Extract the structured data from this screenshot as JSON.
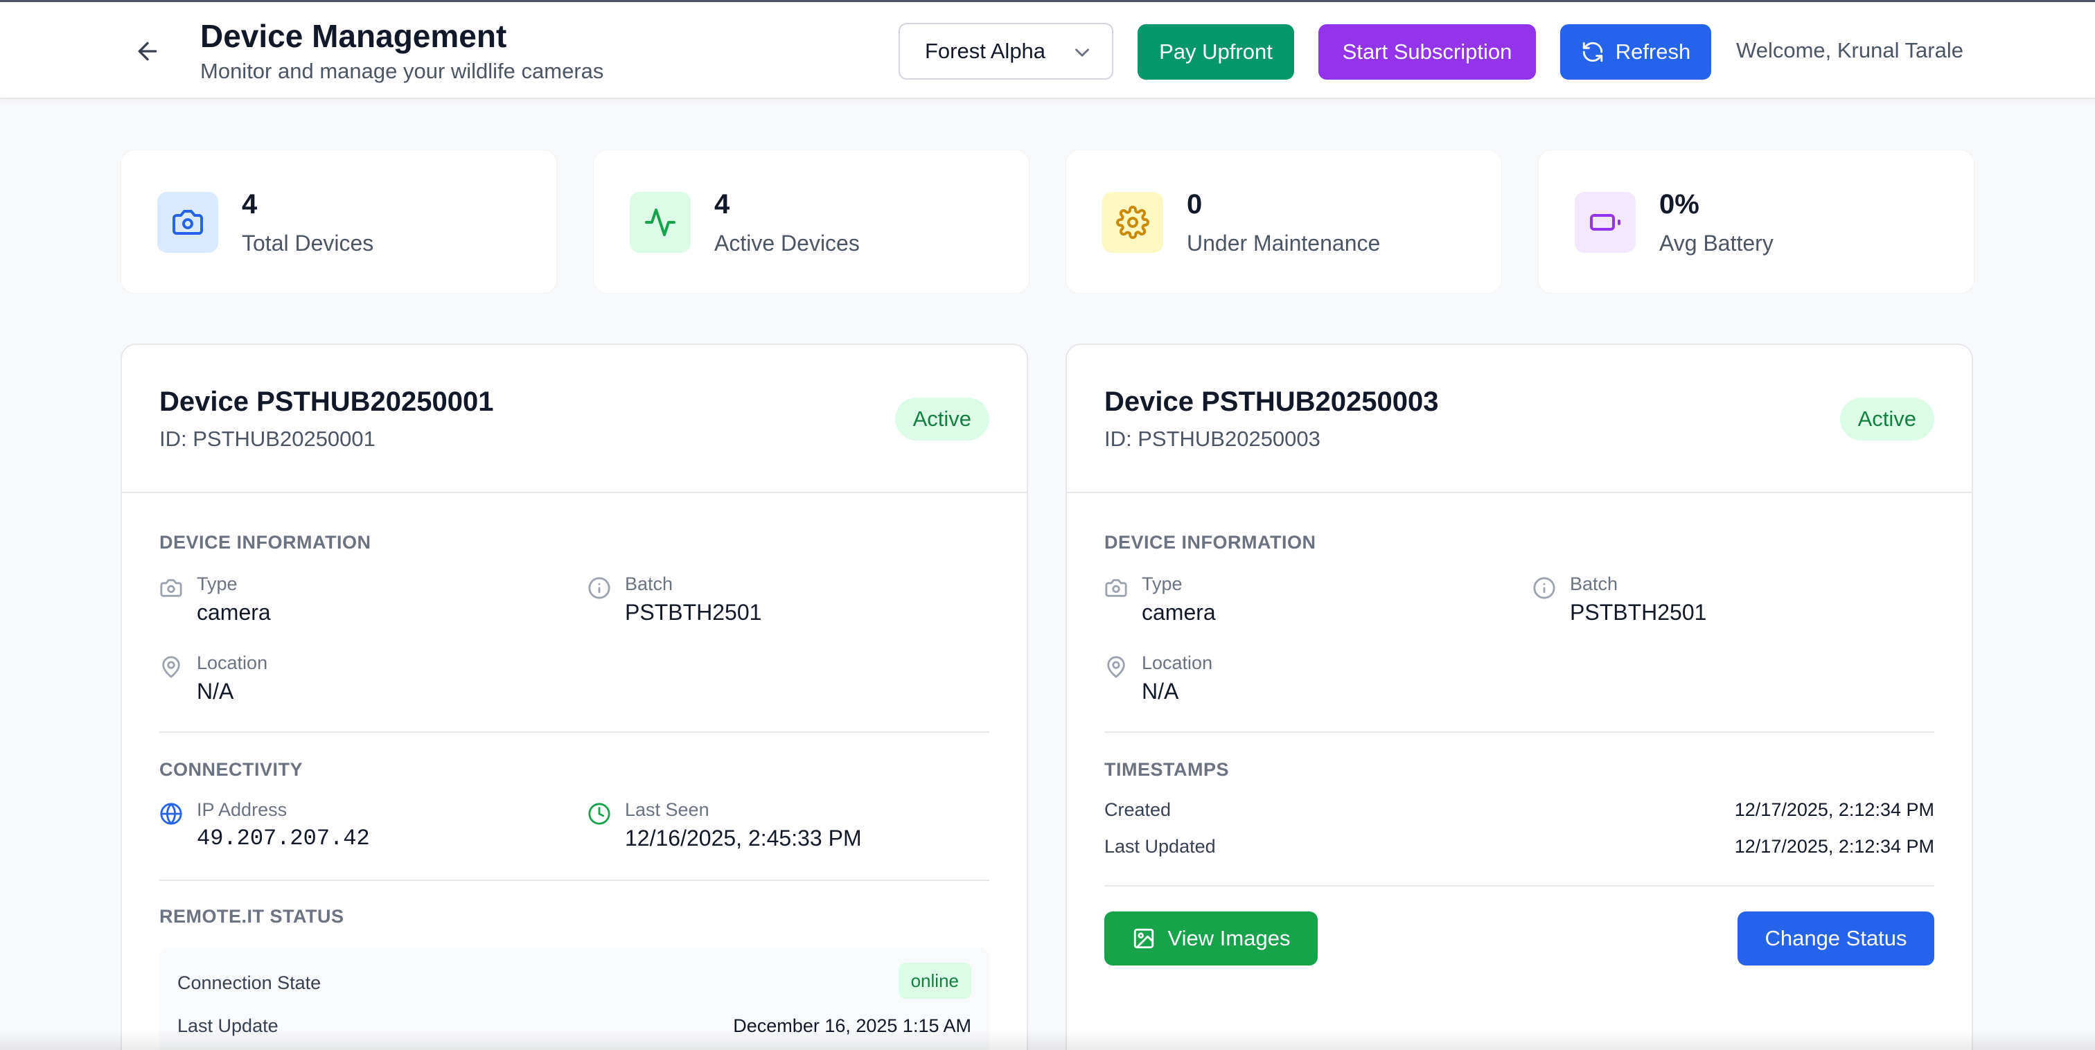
{
  "header": {
    "title": "Device Management",
    "subtitle": "Monitor and manage your wildlife cameras",
    "forest_select": "Forest Alpha",
    "pay_upfront": "Pay Upfront",
    "start_subscription": "Start Subscription",
    "refresh": "Refresh",
    "welcome": "Welcome, Krunal Tarale"
  },
  "stats": [
    {
      "value": "4",
      "label": "Total Devices",
      "icon": "camera-icon",
      "color": "#2563eb",
      "bg": "#dbeafe"
    },
    {
      "value": "4",
      "label": "Active Devices",
      "icon": "activity-icon",
      "color": "#16a34a",
      "bg": "#dcfce7"
    },
    {
      "value": "0",
      "label": "Under Maintenance",
      "icon": "gear-icon",
      "color": "#ca8a04",
      "bg": "#fef9c3"
    },
    {
      "value": "0%",
      "label": "Avg Battery",
      "icon": "battery-icon",
      "color": "#9333ea",
      "bg": "#f3e8ff"
    }
  ],
  "devices": [
    {
      "name": "Device PSTHUB20250001",
      "id": "ID: PSTHUB20250001",
      "status": "Active",
      "info_title": "DEVICE INFORMATION",
      "type_label": "Type",
      "type": "camera",
      "batch_label": "Batch",
      "batch": "PSTBTH2501",
      "location_label": "Location",
      "location": "N/A",
      "connectivity_title": "CONNECTIVITY",
      "ip_label": "IP Address",
      "ip": "49.207.207.42",
      "last_seen_label": "Last Seen",
      "last_seen": "12/16/2025, 2:45:33 PM",
      "remote_title": "REMOTE.IT STATUS",
      "conn_state_label": "Connection State",
      "conn_state": "online",
      "last_update_label": "Last Update",
      "last_update": "December 16, 2025 1:15 AM"
    },
    {
      "name": "Device PSTHUB20250003",
      "id": "ID: PSTHUB20250003",
      "status": "Active",
      "info_title": "DEVICE INFORMATION",
      "type_label": "Type",
      "type": "camera",
      "batch_label": "Batch",
      "batch": "PSTBTH2501",
      "location_label": "Location",
      "location": "N/A",
      "timestamps_title": "TIMESTAMPS",
      "created_label": "Created",
      "created": "12/17/2025, 2:12:34 PM",
      "updated_label": "Last Updated",
      "updated": "12/17/2025, 2:12:34 PM",
      "view_images": "View Images",
      "change_status": "Change Status"
    }
  ]
}
